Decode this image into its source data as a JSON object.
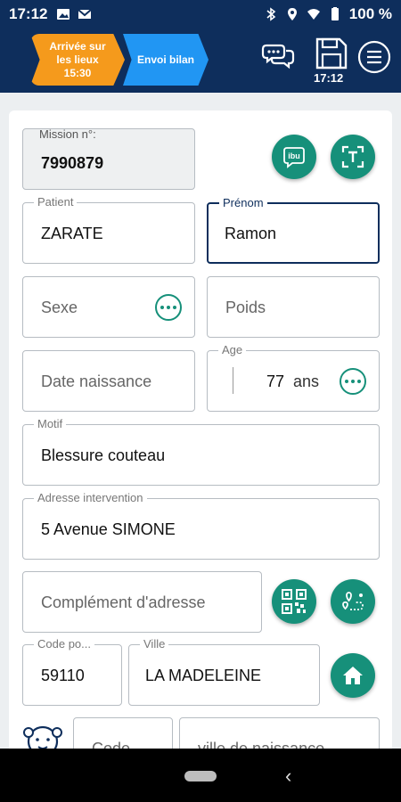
{
  "status_bar": {
    "time": "17:12",
    "battery": "100 %",
    "icons": [
      "image-icon",
      "gmail-icon",
      "bluetooth-icon",
      "location-icon",
      "wifi-icon",
      "battery-icon"
    ]
  },
  "header": {
    "step1_label": "Arrivée sur les lieux 15:30",
    "step1_lines": [
      "Arrivée sur",
      "les lieux",
      "15:30"
    ],
    "step2_label": "Envoi bilan",
    "save_time": "17:12",
    "icons": [
      "chat-icon",
      "save-icon",
      "menu-icon"
    ]
  },
  "form": {
    "mission": {
      "label": "Mission n°:",
      "value": "7990879"
    },
    "patient": {
      "label": "Patient",
      "value": "ZARATE"
    },
    "prenom": {
      "label": "Prénom",
      "value": "Ramon"
    },
    "sexe": {
      "placeholder": "Sexe"
    },
    "poids": {
      "placeholder": "Poids"
    },
    "date_naissance": {
      "placeholder": "Date naissance"
    },
    "age": {
      "label": "Age",
      "value": "77",
      "unit": "ans"
    },
    "motif": {
      "label": "Motif",
      "value": "Blessure couteau"
    },
    "adresse": {
      "label": "Adresse intervention",
      "value": "5 Avenue SIMONE"
    },
    "complement": {
      "placeholder": "Complément d'adresse"
    },
    "code_postal": {
      "label": "Code po...",
      "value": "59110"
    },
    "ville": {
      "label": "Ville",
      "value": "LA MADELEINE"
    },
    "code_naissance": {
      "placeholder": "Code"
    },
    "ville_naissance": {
      "placeholder": "ville de naissance"
    }
  },
  "colors": {
    "header_bg": "#0e2e5c",
    "step1": "#f59a1c",
    "step2": "#2196f3",
    "action_green": "#16907a"
  }
}
